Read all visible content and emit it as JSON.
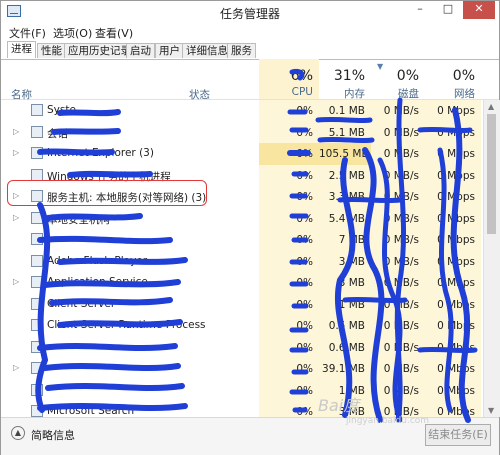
{
  "window": {
    "title": "任务管理器",
    "controls": [
      "–",
      "□",
      "✕"
    ]
  },
  "menubar": [
    "文件(F)",
    "选项(O)",
    "查看(V)"
  ],
  "tabs": [
    "进程",
    "性能",
    "应用历史记录",
    "启动",
    "用户",
    "详细信息",
    "服务"
  ],
  "header": {
    "name": "名称",
    "status": "状态",
    "cpu": {
      "pct": "6%",
      "label": "CPU"
    },
    "memory": {
      "pct": "31%",
      "label": "内存"
    },
    "disk": {
      "pct": "0%",
      "label": "磁盘"
    },
    "network": {
      "pct": "0%",
      "label": "网络"
    }
  },
  "rows": [
    {
      "name": "Syste",
      "expand": "",
      "cpu": "0%",
      "mem": "0.1 MB",
      "disk": "0 MB/s",
      "net": "0 Mbps"
    },
    {
      "name": "会话",
      "expand": "▷",
      "cpu": "0%",
      "mem": "5.1 MB",
      "disk": "0 MB/s",
      "net": "0 Mbps"
    },
    {
      "name": "Internet Explorer (3)",
      "expand": "▷",
      "cpu": "0%",
      "mem": "105.5 MB",
      "disk": "0 MB/s",
      "net": "0 Mbps",
      "hl": true
    },
    {
      "name": "Windows 任务的主机进程",
      "expand": "",
      "cpu": "0%",
      "mem": "2.5 MB",
      "disk": "0 MB/s",
      "net": "0 Mbps"
    },
    {
      "name": "服务主机: 本地服务(对等网络) (3)",
      "expand": "▷",
      "cpu": "0%",
      "mem": "3.3 MB",
      "disk": "0 MB/s",
      "net": "0 Mbps"
    },
    {
      "name": "本地安全机构",
      "expand": "▷",
      "cpu": "0%",
      "mem": "5.4 MB",
      "disk": "0 MB/s",
      "net": "0 Mbps"
    },
    {
      "name": "",
      "expand": "",
      "cpu": "0%",
      "mem": "7 MB",
      "disk": "0 MB/s",
      "net": "0 Mbps"
    },
    {
      "name": "Adobe Flash Player",
      "expand": "",
      "cpu": "0%",
      "mem": "3 MB",
      "disk": "0 MB/s",
      "net": "0 Mbps"
    },
    {
      "name": "Application Service",
      "expand": "▷",
      "cpu": "0%",
      "mem": "3 MB",
      "disk": "0 MB/s",
      "net": "0 Mbps"
    },
    {
      "name": "Client Server",
      "expand": "",
      "cpu": "0%",
      "mem": "1 MB",
      "disk": "0 MB/s",
      "net": "0 Mbps"
    },
    {
      "name": "Client Server Runtime Process",
      "expand": "",
      "cpu": "0%",
      "mem": "0.5 MB",
      "disk": "0 MB/s",
      "net": "0 Mbps"
    },
    {
      "name": "",
      "expand": "",
      "cpu": "0%",
      "mem": "0.6 MB",
      "disk": "0 MB/s",
      "net": "0 Mbps"
    },
    {
      "name": "",
      "expand": "▷",
      "cpu": "0%",
      "mem": "39.1 MB",
      "disk": "0 MB/s",
      "net": "0 Mbps"
    },
    {
      "name": "",
      "expand": "",
      "cpu": "0%",
      "mem": "1 MB",
      "disk": "0 MB/s",
      "net": "0 Mbps"
    },
    {
      "name": "Microsoft Search",
      "expand": "",
      "cpu": "0%",
      "mem": "3 MB",
      "disk": "0 MB/s",
      "net": "0 Mbps"
    }
  ],
  "footer": {
    "fewer_details": "简略信息",
    "end_task": "结束任务(E)"
  },
  "watermark": {
    "line1": "Bai度",
    "line2": "jingyan.baidu.com"
  },
  "colors": {
    "cpu_tint": "#fdf6d8",
    "highlight": "#f8e6a0",
    "annotation_red": "#e23a3a",
    "scribble_blue": "#1f3fd6"
  }
}
